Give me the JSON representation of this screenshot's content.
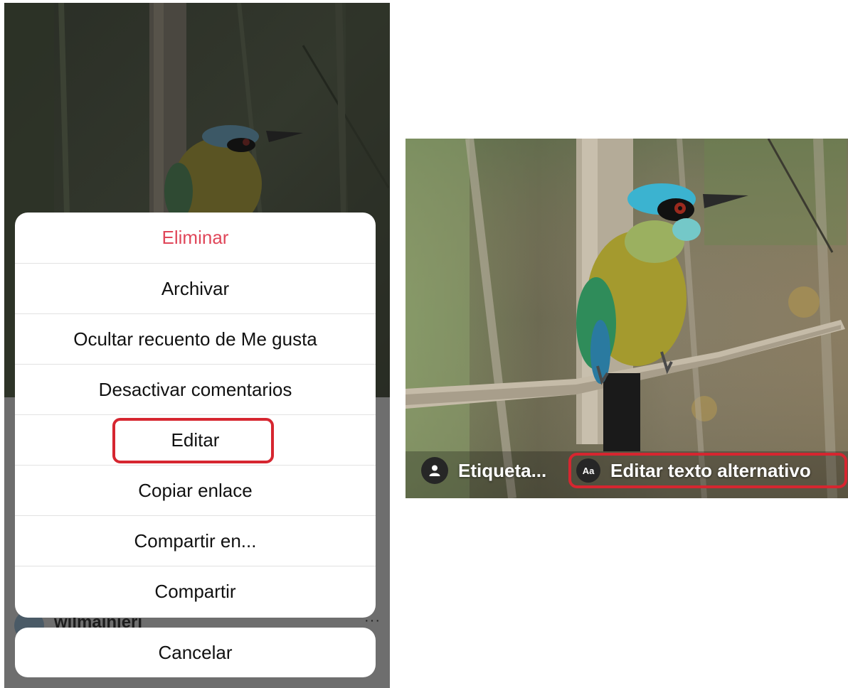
{
  "action_sheet": {
    "items": [
      {
        "label": "Eliminar",
        "destructive": true
      },
      {
        "label": "Archivar"
      },
      {
        "label": "Ocultar recuento de Me gusta"
      },
      {
        "label": "Desactivar comentarios"
      },
      {
        "label": "Editar",
        "highlighted": true
      },
      {
        "label": "Copiar enlace"
      },
      {
        "label": "Compartir en..."
      },
      {
        "label": "Compartir"
      }
    ],
    "cancel_label": "Cancelar"
  },
  "post": {
    "username": "wilmainieri",
    "more_icon": "···"
  },
  "photo_overlay": {
    "tag_people_label": "Etiqueta...",
    "tag_people_icon": "person-icon",
    "alt_text_label": "Editar texto alternativo",
    "alt_text_icon_text": "Aa"
  },
  "colors": {
    "destructive": "#e0475a",
    "highlight": "#d62630"
  }
}
